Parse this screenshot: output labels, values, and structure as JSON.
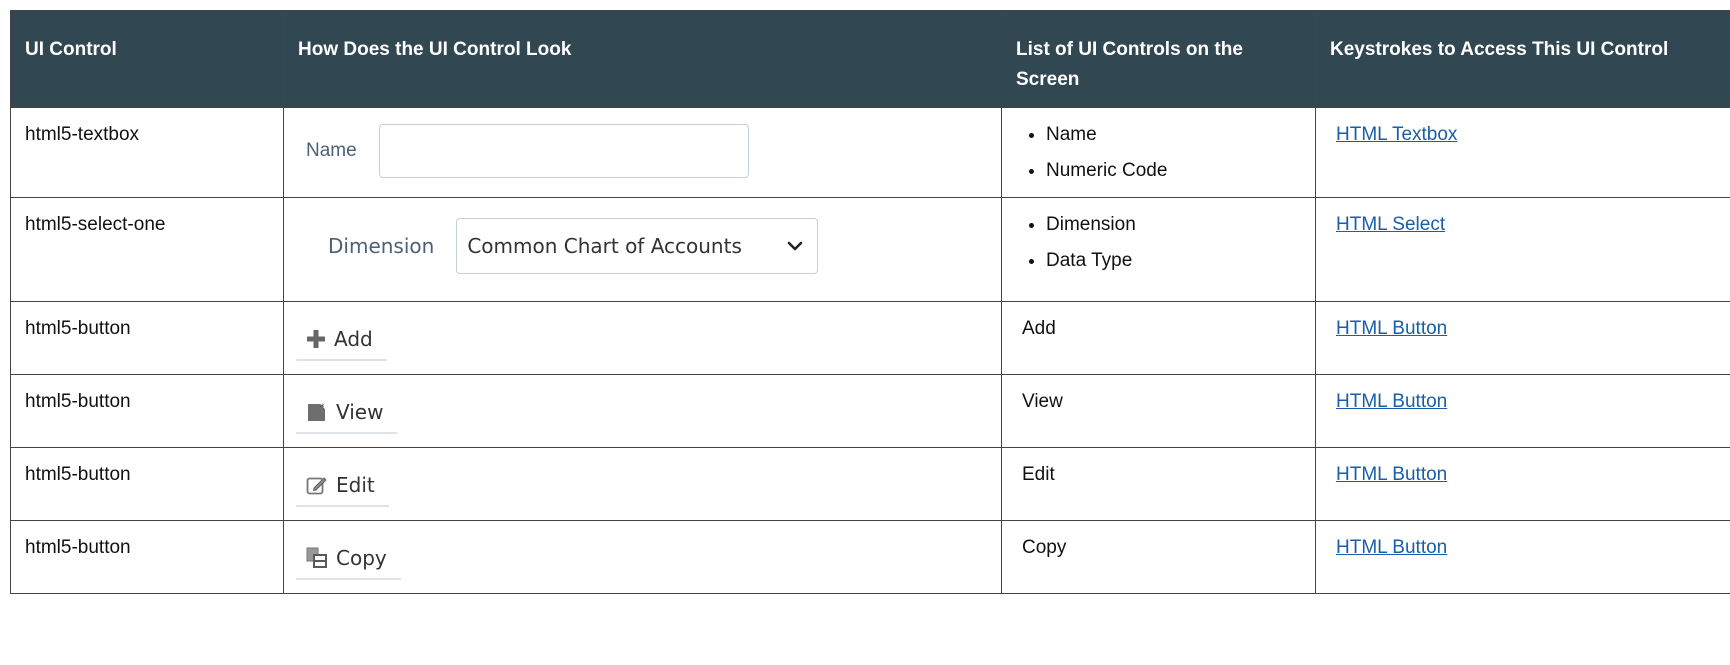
{
  "columns": [
    "UI Control",
    "How Does the UI Control Look",
    "List of UI Controls on the Screen",
    "Keystrokes to Access This UI Control"
  ],
  "rows": [
    {
      "control": "html5-textbox",
      "mock": {
        "label": "Name",
        "value": ""
      },
      "list": [
        "Name",
        "Numeric Code"
      ],
      "keys": " HTML Textbox"
    },
    {
      "control": "html5-select-one",
      "mock": {
        "label": "Dimension",
        "selected": "Common Chart of Accounts"
      },
      "list": [
        "Dimension",
        "Data Type"
      ],
      "keys": "HTML Select"
    },
    {
      "control": "html5-button",
      "mock": {
        "label": "Add",
        "icon": "plus-icon"
      },
      "list_text": "Add",
      "keys": "HTML Button"
    },
    {
      "control": "html5-button",
      "mock": {
        "label": "View",
        "icon": "view-document-icon"
      },
      "list_text": "View",
      "keys": "HTML Button"
    },
    {
      "control": "html5-button",
      "mock": {
        "label": "Edit",
        "icon": "edit-pencil-icon"
      },
      "list_text": "Edit",
      "keys": "HTML Button"
    },
    {
      "control": "html5-button",
      "mock": {
        "label": "Copy",
        "icon": "copy-icon"
      },
      "list_text": "Copy",
      "keys": "HTML Button"
    }
  ],
  "colors": {
    "header_bg": "#314752",
    "header_text": "#ffffff",
    "link": "#1a5ea8",
    "border": "#444444"
  }
}
